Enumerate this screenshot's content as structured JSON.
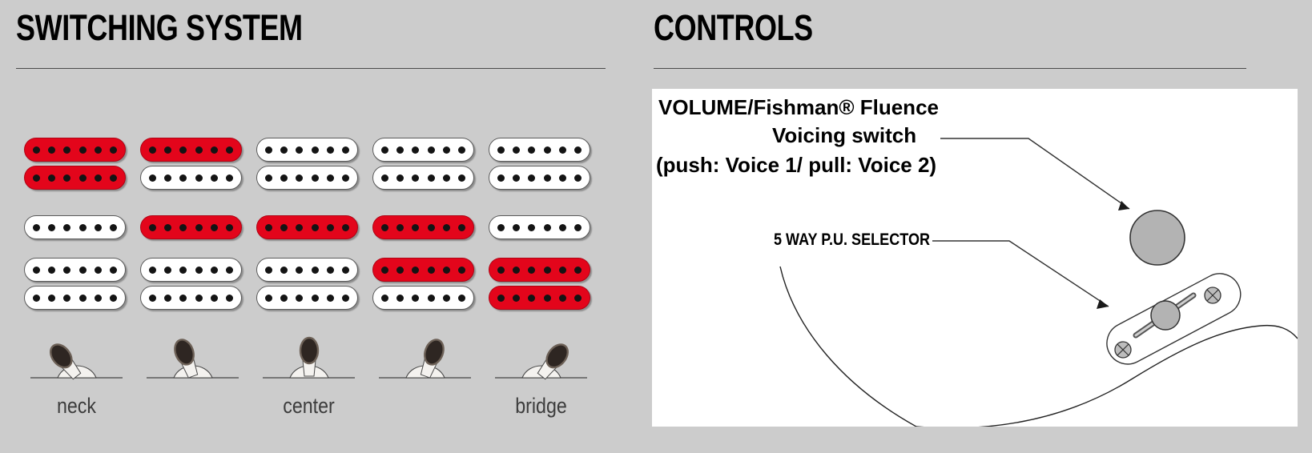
{
  "sections": {
    "switching": {
      "title": "SWITCHING SYSTEM"
    },
    "controls": {
      "title": "CONTROLS"
    }
  },
  "colors": {
    "background": "#cccccc",
    "active_pickup": "#e3051b",
    "inactive_pickup": "#ffffff",
    "pole_piece": "#141414",
    "rule": "#4a4a4a",
    "panel": "#ffffff",
    "knob_fill": "#b3b3b3"
  },
  "switching": {
    "positions": [
      {
        "index": 1,
        "label": "neck",
        "lever_angle": -38,
        "neck": {
          "type": "humbucker",
          "coils": [
            "on",
            "on"
          ]
        },
        "middle": {
          "type": "single",
          "coils": [
            "off"
          ]
        },
        "bridge": {
          "type": "humbucker",
          "coils": [
            "off",
            "off"
          ]
        }
      },
      {
        "index": 2,
        "label": "",
        "lever_angle": -20,
        "neck": {
          "type": "humbucker",
          "coils": [
            "on",
            "off"
          ]
        },
        "middle": {
          "type": "single",
          "coils": [
            "on"
          ]
        },
        "bridge": {
          "type": "humbucker",
          "coils": [
            "off",
            "off"
          ]
        }
      },
      {
        "index": 3,
        "label": "center",
        "lever_angle": 0,
        "neck": {
          "type": "humbucker",
          "coils": [
            "off",
            "off"
          ]
        },
        "middle": {
          "type": "single",
          "coils": [
            "on"
          ]
        },
        "bridge": {
          "type": "humbucker",
          "coils": [
            "off",
            "off"
          ]
        }
      },
      {
        "index": 4,
        "label": "",
        "lever_angle": 20,
        "neck": {
          "type": "humbucker",
          "coils": [
            "off",
            "off"
          ]
        },
        "middle": {
          "type": "single",
          "coils": [
            "on"
          ]
        },
        "bridge": {
          "type": "humbucker",
          "coils": [
            "on",
            "off"
          ]
        }
      },
      {
        "index": 5,
        "label": "bridge",
        "lever_angle": 38,
        "neck": {
          "type": "humbucker",
          "coils": [
            "off",
            "off"
          ]
        },
        "middle": {
          "type": "single",
          "coils": [
            "off"
          ]
        },
        "bridge": {
          "type": "humbucker",
          "coils": [
            "on",
            "on"
          ]
        }
      }
    ],
    "poles_per_coil": 6
  },
  "controls": {
    "volume_line_1": "VOLUME/Fishman® Fluence",
    "volume_line_2": "Voicing switch",
    "volume_line_3": "(push: Voice 1/ pull: Voice 2)",
    "selector_label": "5 WAY P.U. SELECTOR"
  }
}
